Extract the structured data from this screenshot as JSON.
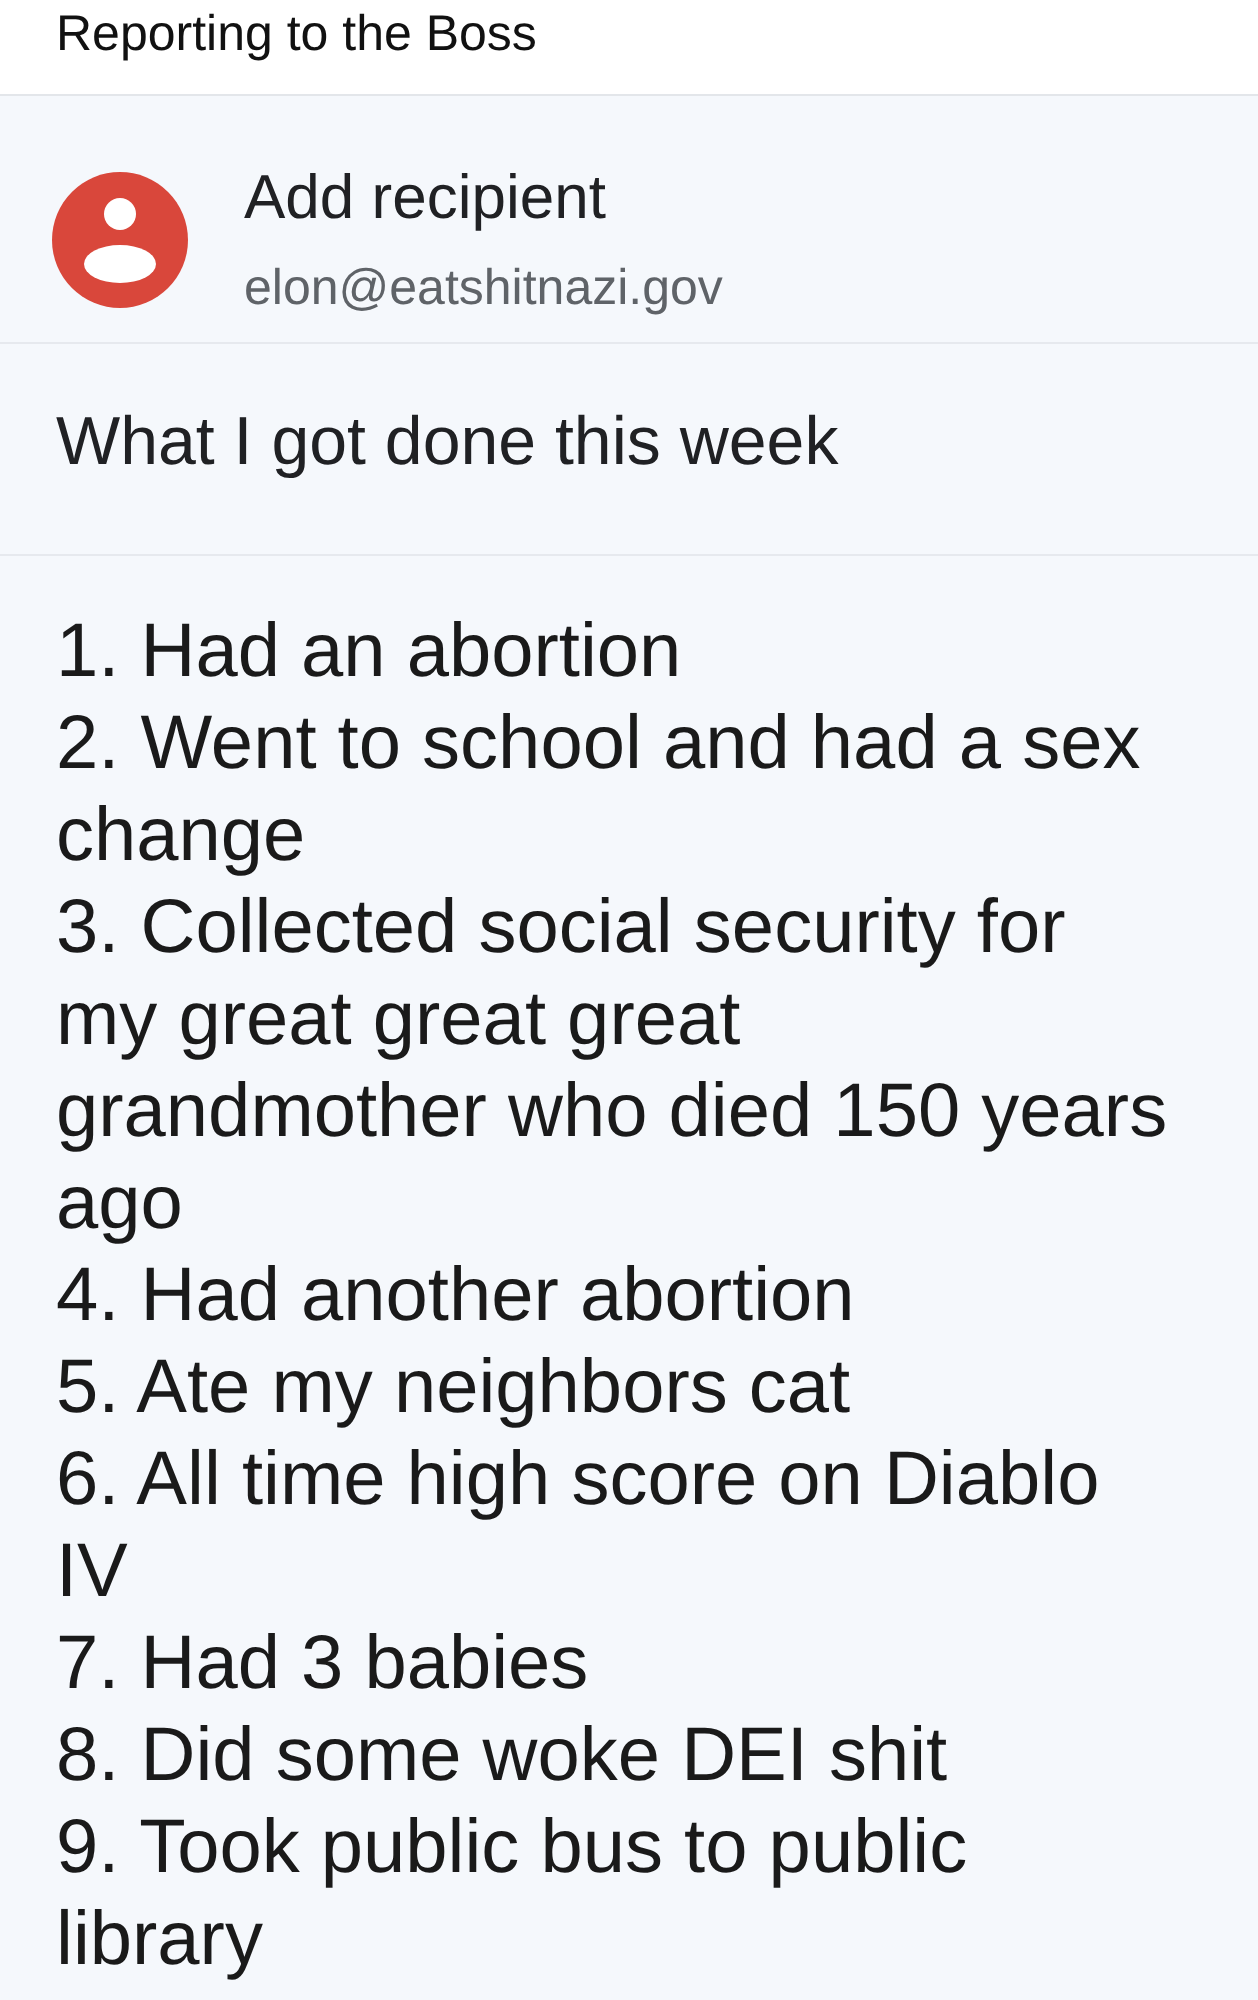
{
  "header": {
    "title": "Reporting to the Boss"
  },
  "recipient": {
    "label": "Add recipient",
    "email": "elon@eatshitnazi.gov"
  },
  "subject": {
    "value": "What I got done this week"
  },
  "body": {
    "items": [
      "1. Had an abortion",
      "2. Went to school and had a sex change",
      "3. Collected social security for my great great great grandmother who died 150 years ago",
      "4. Had another abortion",
      "5. Ate my neighbors cat",
      "6. All time high score on Diablo IV",
      "7. Had 3 babies",
      "8. Did some woke DEI shit",
      "9. Took public bus to public library"
    ]
  }
}
